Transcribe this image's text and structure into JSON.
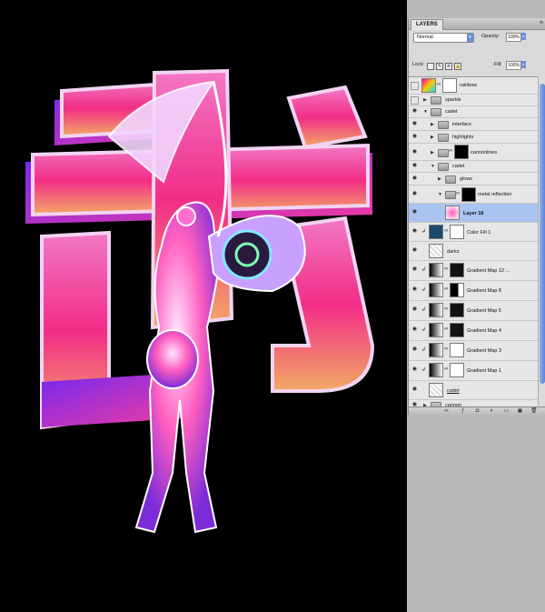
{
  "panel": {
    "tab": "LAYERS",
    "menu_icon": "panel-menu-icon",
    "blend_mode": "Normal",
    "opacity_label": "Opacity:",
    "opacity_value": "100%",
    "lock_label": "Lock:",
    "fill_label": "Fill:",
    "fill_value": "100%"
  },
  "layers": [
    {
      "name": "rainbow",
      "kind": "layer",
      "visible": false
    },
    {
      "name": "sparkle",
      "kind": "group",
      "visible": false
    },
    {
      "name": "cadet",
      "kind": "group",
      "visible": true,
      "expanded": true
    },
    {
      "name": "interface",
      "kind": "group",
      "visible": true
    },
    {
      "name": "highlights",
      "kind": "group",
      "visible": true
    },
    {
      "name": "cannonlines",
      "kind": "group",
      "visible": true
    },
    {
      "name": "cadet",
      "kind": "group",
      "visible": true,
      "expanded": true
    },
    {
      "name": "glows",
      "kind": "group",
      "visible": true
    },
    {
      "name": "metal reflection",
      "kind": "group",
      "visible": true
    },
    {
      "name": "Layer 18",
      "kind": "layer",
      "visible": true,
      "selected": true
    },
    {
      "name": "Color Fill 1",
      "kind": "fill",
      "visible": true
    },
    {
      "name": "darks",
      "kind": "layer",
      "visible": true
    },
    {
      "name": "Gradient Map 12 ...",
      "kind": "adjust",
      "visible": true
    },
    {
      "name": "Gradient Map 8",
      "kind": "adjust",
      "visible": true
    },
    {
      "name": "Gradient Map 5",
      "kind": "adjust",
      "visible": true
    },
    {
      "name": "Gradient Map 4",
      "kind": "adjust",
      "visible": true
    },
    {
      "name": "Gradient Map 3",
      "kind": "adjust",
      "visible": true
    },
    {
      "name": "Gradient Map 1",
      "kind": "adjust",
      "visible": true
    },
    {
      "name": "cadet",
      "kind": "layer",
      "visible": true
    },
    {
      "name": "cannon",
      "kind": "group",
      "visible": true
    }
  ],
  "colors": {
    "canvas": "#000000",
    "panel": "#d9d9d9",
    "selected": "#a9c4f0",
    "accent_pink": "#ff3fa8",
    "accent_cyan": "#7fe8ff"
  }
}
